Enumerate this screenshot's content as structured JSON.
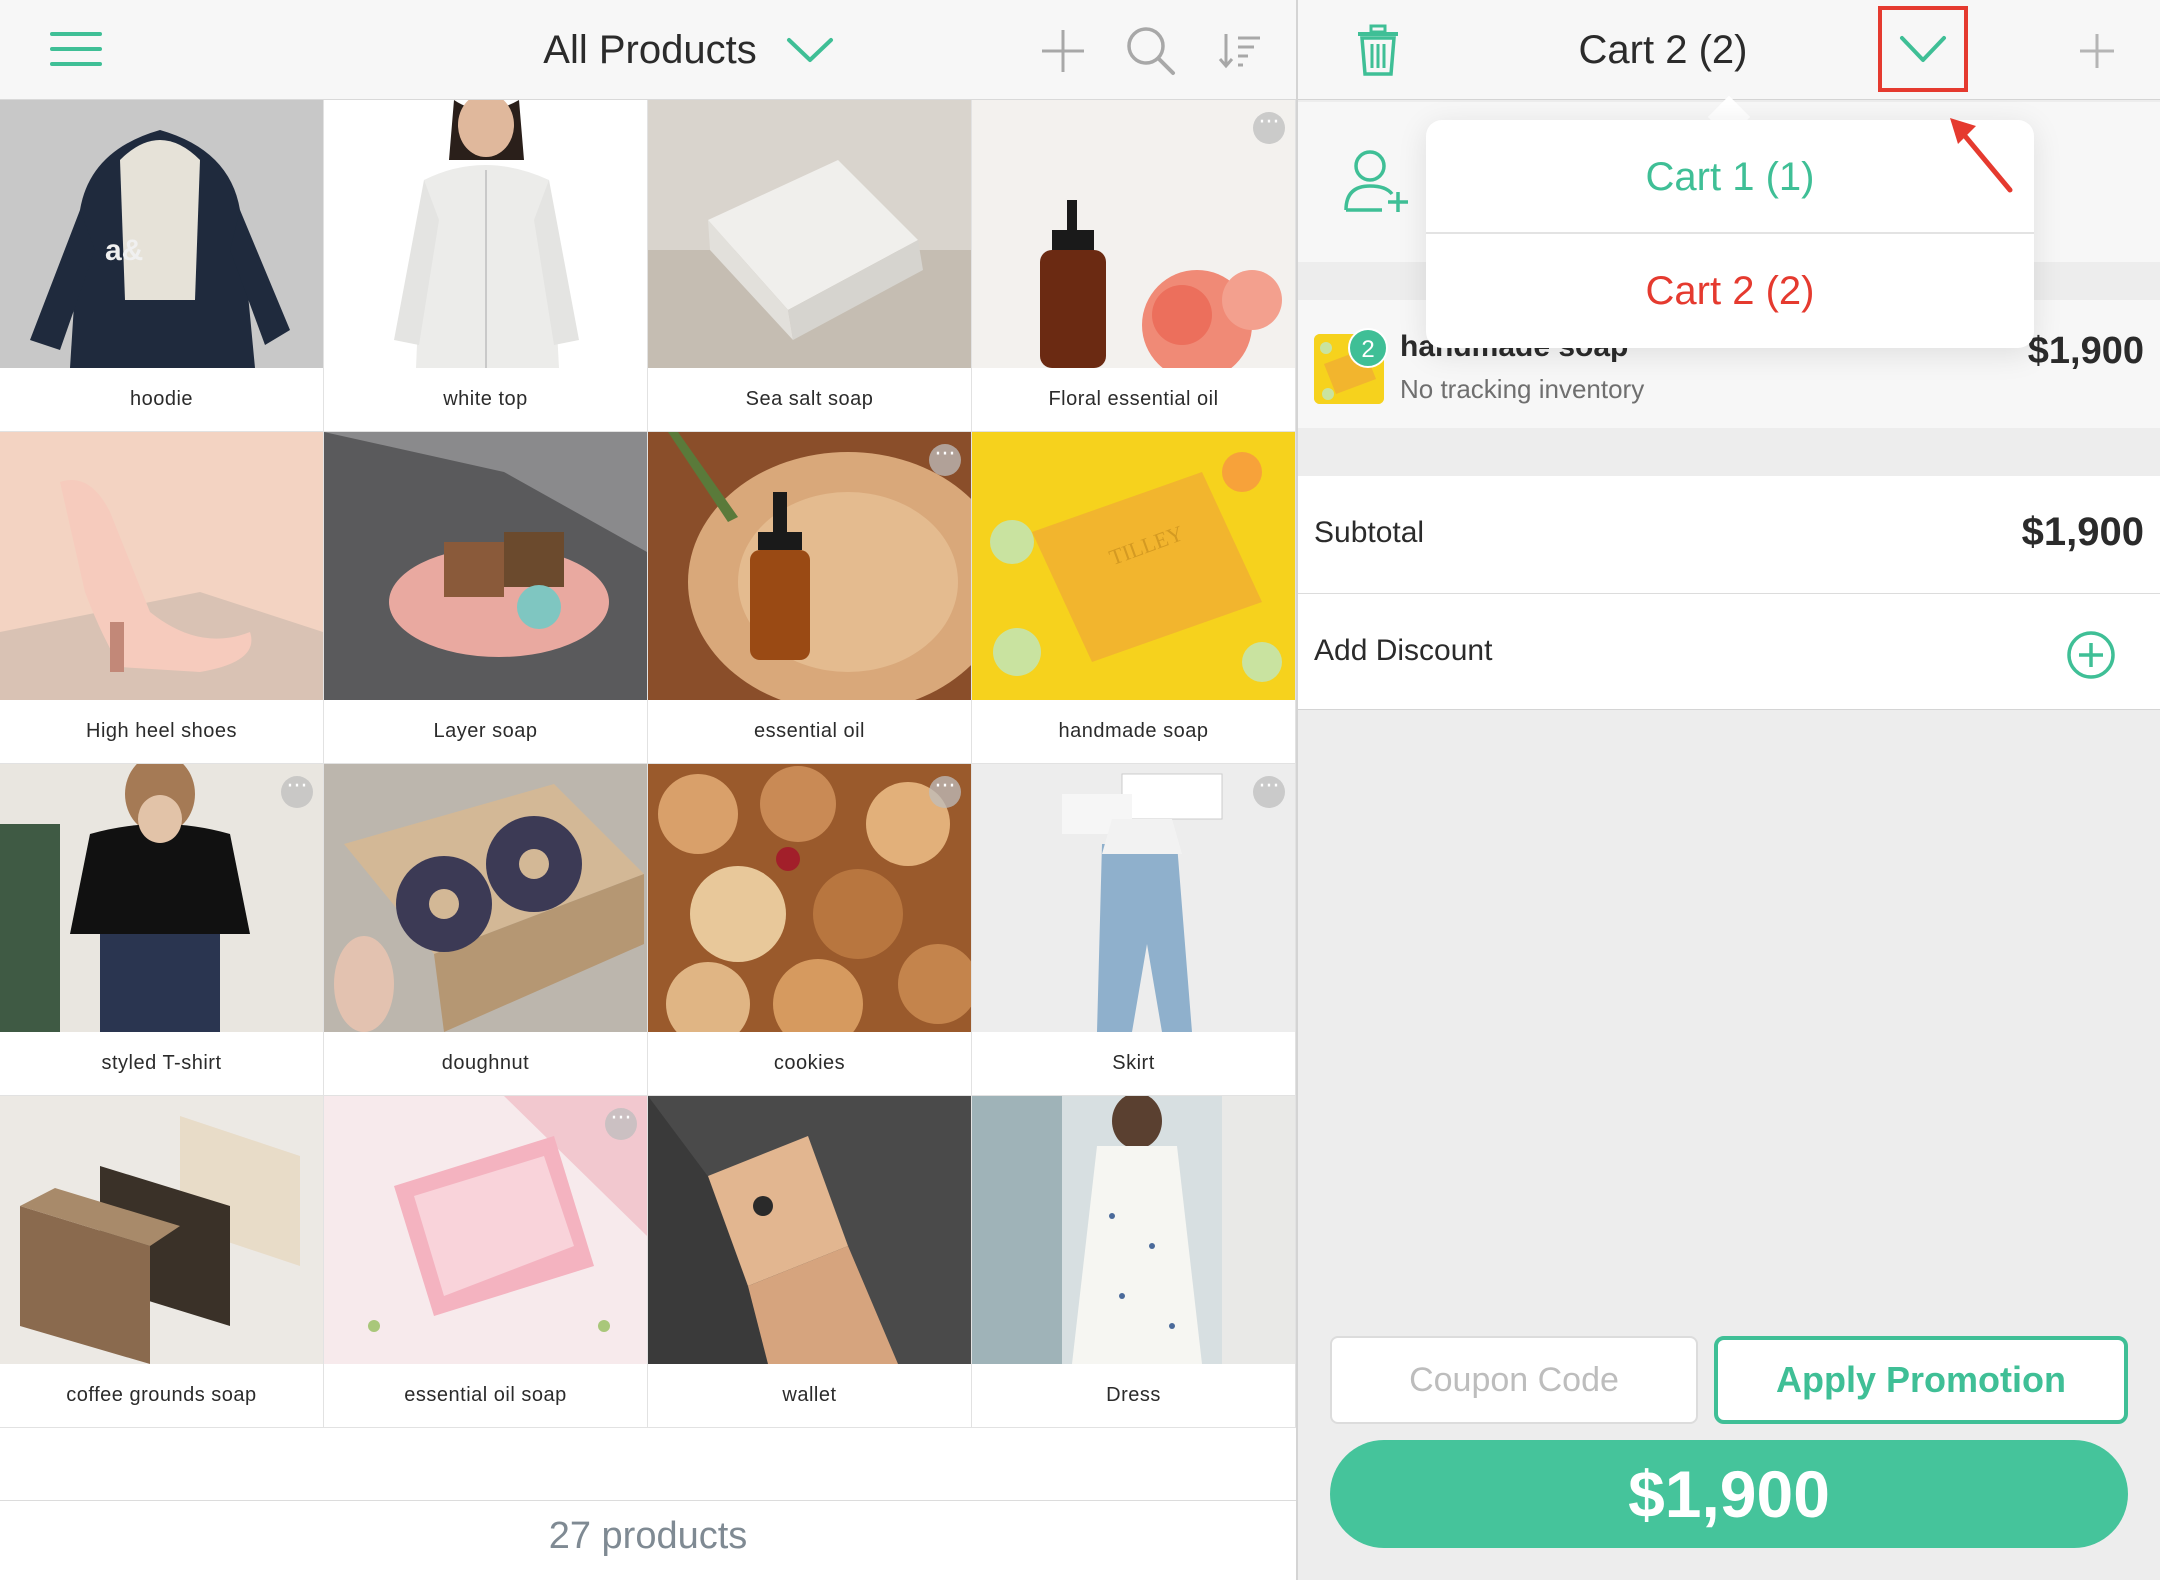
{
  "left_header": {
    "title": "All Products"
  },
  "products": [
    {
      "name": "hoodie",
      "more": false
    },
    {
      "name": "white top",
      "more": false
    },
    {
      "name": "Sea salt soap",
      "more": false
    },
    {
      "name": "Floral essential oil",
      "more": true
    },
    {
      "name": "High heel shoes",
      "more": false
    },
    {
      "name": "Layer soap",
      "more": false
    },
    {
      "name": "essential oil",
      "more": true
    },
    {
      "name": "handmade soap",
      "more": false
    },
    {
      "name": "styled T-shirt",
      "more": true
    },
    {
      "name": "doughnut",
      "more": false
    },
    {
      "name": "cookies",
      "more": true
    },
    {
      "name": "Skirt",
      "more": true
    },
    {
      "name": "coffee grounds soap",
      "more": false
    },
    {
      "name": "essential oil soap",
      "more": true
    },
    {
      "name": "wallet",
      "more": false
    },
    {
      "name": "Dress",
      "more": false
    }
  ],
  "footer": {
    "product_count": "27 products"
  },
  "cart_header": {
    "title": "Cart 2 (2)"
  },
  "cart_dropdown": {
    "items": [
      {
        "label": "Cart 1 (1)"
      },
      {
        "label": "Cart 2 (2)"
      }
    ]
  },
  "cart_item": {
    "name": "handmade soap",
    "quantity": "2",
    "inventory_note": "No tracking inventory",
    "price": "$1,900"
  },
  "totals": {
    "subtotal_label": "Subtotal",
    "subtotal_value": "$1,900",
    "discount_label": "Add Discount"
  },
  "actions": {
    "coupon_placeholder": "Coupon Code",
    "apply_label": "Apply Promotion",
    "pay_label": "$1,900"
  },
  "colors": {
    "accent": "#3fbf96",
    "highlight": "#e53a2f"
  }
}
